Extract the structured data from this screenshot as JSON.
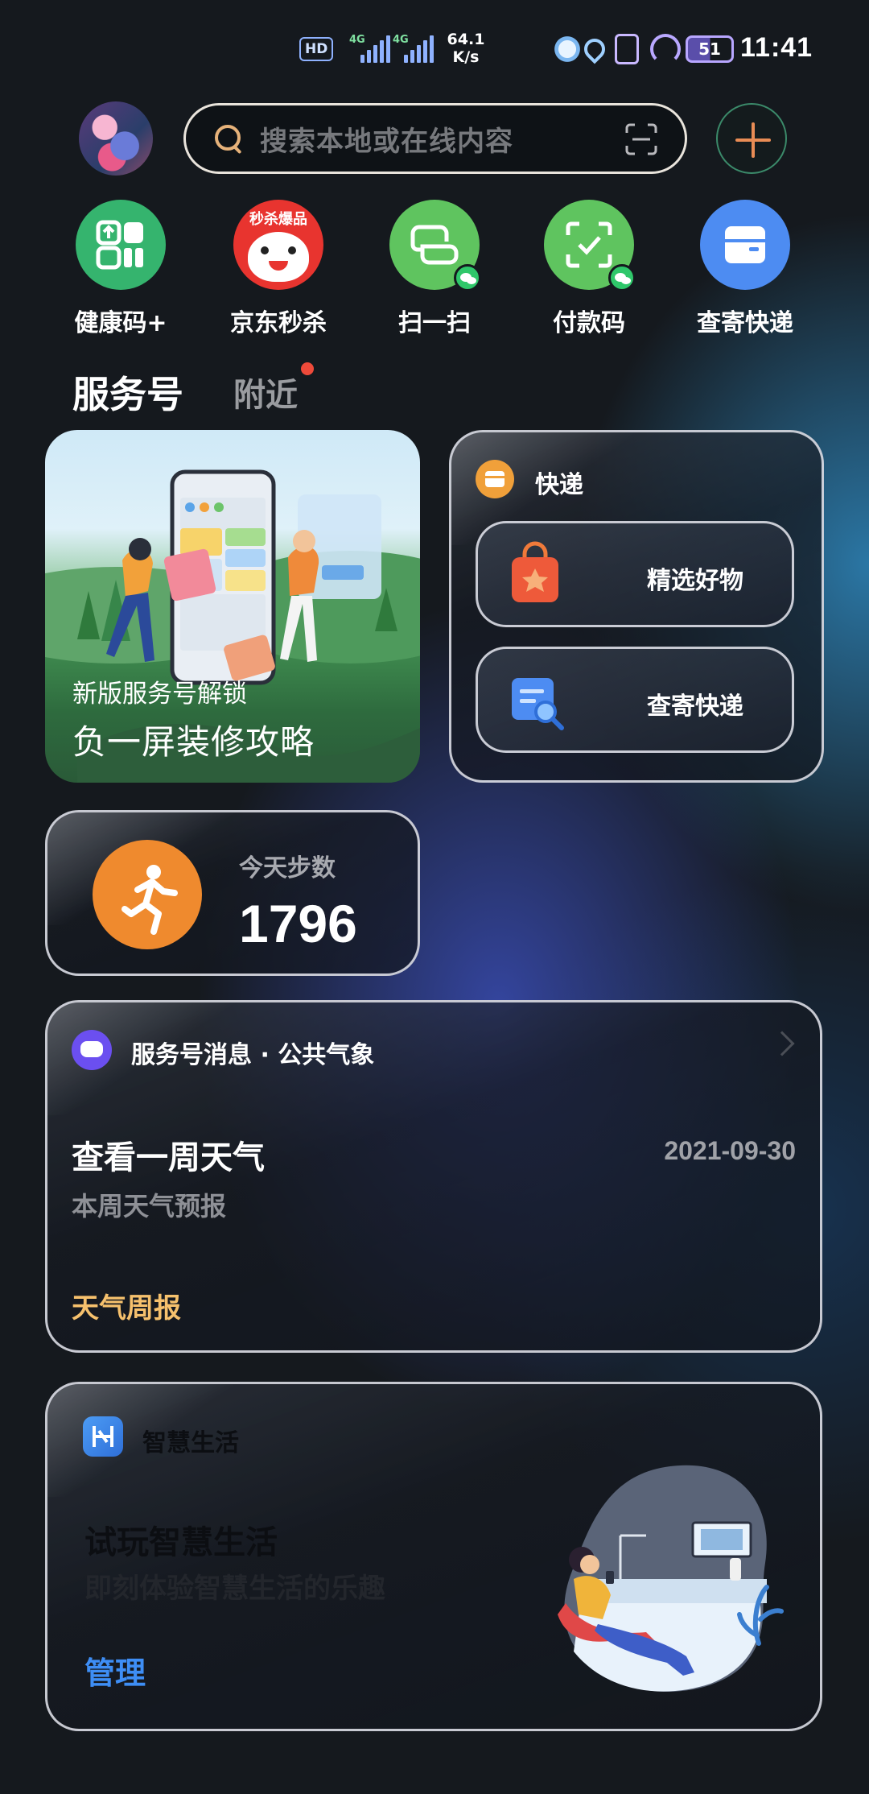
{
  "status_bar": {
    "hd_badge": "HD",
    "network_type": "4G",
    "speed_value": "64.1",
    "speed_unit": "K/s",
    "battery": "51",
    "time": "11:41",
    "icons": [
      "alarm-icon",
      "location-icon",
      "vibrate-icon",
      "speed-icon"
    ]
  },
  "header": {
    "search_placeholder": "搜索本地或在线内容"
  },
  "quick_apps": [
    {
      "label": "健康码+",
      "color": "#35b46e",
      "icon": "health-code-icon"
    },
    {
      "label": "京东秒杀",
      "color": "#e8342f",
      "icon": "jd-icon",
      "badge_text": "秒杀爆品"
    },
    {
      "label": "扫一扫",
      "color": "#5fc45f",
      "icon": "scan-icon"
    },
    {
      "label": "付款码",
      "color": "#5fc45f",
      "icon": "pay-code-icon"
    },
    {
      "label": "查寄快递",
      "color": "#4d8cf2",
      "icon": "package-icon"
    }
  ],
  "tabs": {
    "active": "服务号",
    "other": "附近"
  },
  "promo_card": {
    "line1": "新版服务号解锁",
    "line2": "负一屏装修攻略"
  },
  "express_card": {
    "title": "快递",
    "items": [
      {
        "label": "精选好物",
        "icon": "shopping-bag-icon"
      },
      {
        "label": "查寄快递",
        "icon": "package-search-icon"
      }
    ]
  },
  "steps_card": {
    "label": "今天步数",
    "value": "1796"
  },
  "message_card": {
    "source": "服务号消息 · 公共气象",
    "title": "查看一周天气",
    "date": "2021-09-30",
    "subtitle": "本周天气预报",
    "footer": "天气周报"
  },
  "smart_life_card": {
    "name": "智慧生活",
    "title": "试玩智慧生活",
    "subtitle": "即刻体验智慧生活的乐趣",
    "action": "管理"
  }
}
